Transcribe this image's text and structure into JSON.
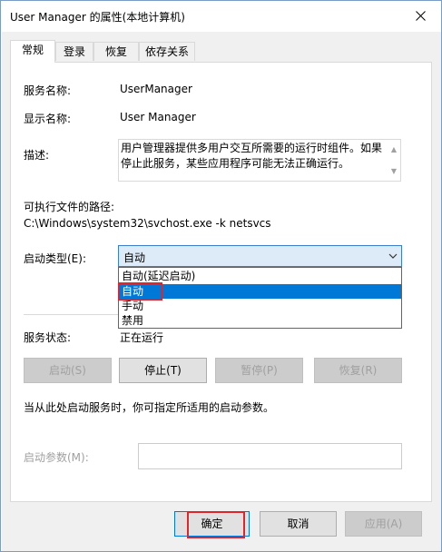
{
  "window": {
    "title": "User Manager 的属性(本地计算机)"
  },
  "tabs": [
    {
      "label": "常规",
      "active": true
    },
    {
      "label": "登录",
      "active": false
    },
    {
      "label": "恢复",
      "active": false
    },
    {
      "label": "依存关系",
      "active": false
    }
  ],
  "general": {
    "service_name_label": "服务名称:",
    "service_name_value": "UserManager",
    "display_name_label": "显示名称:",
    "display_name_value": "User Manager",
    "description_label": "描述:",
    "description_value": "用户管理器提供多用户交互所需要的运行时组件。如果停止此服务，某些应用程序可能无法正确运行。",
    "exe_path_label": "可执行文件的路径:",
    "exe_path_value": "C:\\Windows\\system32\\svchost.exe -k netsvcs",
    "startup_type_label": "启动类型(E):",
    "startup_type_value": "自动",
    "startup_options": [
      "自动(延迟启动)",
      "自动",
      "手动",
      "禁用"
    ],
    "startup_selected_index": 1,
    "status_label": "服务状态:",
    "status_value": "正在运行",
    "btn_start": "启动(S)",
    "btn_stop": "停止(T)",
    "btn_pause": "暂停(P)",
    "btn_resume": "恢复(R)",
    "params_hint": "当从此处启动服务时，你可指定所适用的启动参数。",
    "params_label": "启动参数(M):",
    "params_value": ""
  },
  "footer": {
    "ok": "确定",
    "cancel": "取消",
    "apply": "应用(A)"
  },
  "icons": {
    "close": "close-icon",
    "dropdown": "chevron-down-icon"
  },
  "colors": {
    "highlight": "#e0252a",
    "selection": "#0078d7",
    "accent": "#3b7fcc"
  }
}
